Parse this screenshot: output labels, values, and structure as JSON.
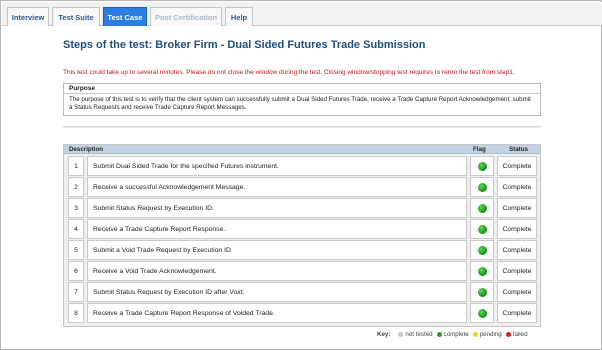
{
  "tabs": [
    {
      "label": "Interview",
      "state": "normal"
    },
    {
      "label": "Test Suite",
      "state": "normal"
    },
    {
      "label": "Test Case",
      "state": "active"
    },
    {
      "label": "Post Certification",
      "state": "disabled"
    },
    {
      "label": "Help",
      "state": "normal"
    }
  ],
  "page_title": "Steps of the test: Broker Firm - Dual Sided Futures Trade Submission",
  "warning_text": "This test could take up to several minutes. Please do not close the window during the test. Closing window/stopping test requires to rerun the test from step1.",
  "purpose": {
    "heading": "Purpose",
    "text": "The purpose of this test is to verify that the client system can successfully submit a Dual Sided Futures Trade, receive a Trade Capture Report Acknowledgement, submit a Status Requests and receive Trade Capture Report Messages."
  },
  "table": {
    "headers": {
      "description": "Description",
      "flag": "Flag",
      "status": "Status"
    },
    "rows": [
      {
        "num": "1",
        "description": "Submit Dual Sided Trade for the specified Futures instrument.",
        "flag": "complete",
        "status": "Complete"
      },
      {
        "num": "2",
        "description": "Receive a successful Acknowledgement Message.",
        "flag": "complete",
        "status": "Complete"
      },
      {
        "num": "3",
        "description": "Submit Status Request by Execution ID.",
        "flag": "complete",
        "status": "Complete"
      },
      {
        "num": "4",
        "description": "Receive a Trade Capture Report Response.",
        "flag": "complete",
        "status": "Complete"
      },
      {
        "num": "5",
        "description": "Submit a Void Trade Request by Execution ID.",
        "flag": "complete",
        "status": "Complete"
      },
      {
        "num": "6",
        "description": "Receive a Void Trade Acknowledgement.",
        "flag": "complete",
        "status": "Complete"
      },
      {
        "num": "7",
        "description": "Submit Status Request by Execution ID after Void.",
        "flag": "complete",
        "status": "Complete"
      },
      {
        "num": "8",
        "description": "Receive a Trade Capture Report Response of Voided Trade.",
        "flag": "complete",
        "status": "Complete"
      }
    ]
  },
  "key": {
    "label": "Key:",
    "items": [
      {
        "label": "not tested",
        "color": "#c8c8c8"
      },
      {
        "label": "complete",
        "color": "#1f9e1f"
      },
      {
        "label": "pending",
        "color": "#e8d81c"
      },
      {
        "label": "failed",
        "color": "#d42020"
      }
    ]
  }
}
